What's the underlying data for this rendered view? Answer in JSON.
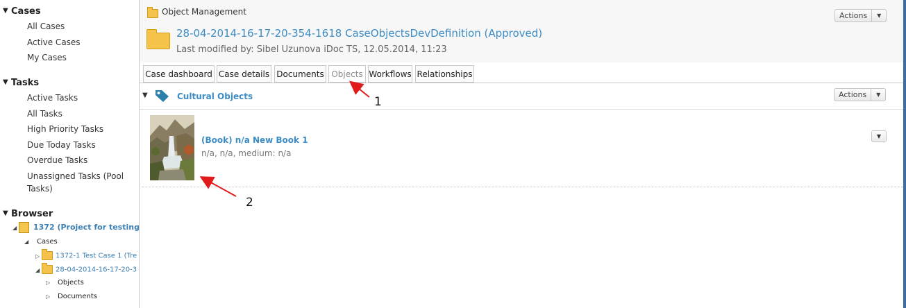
{
  "sidebar": {
    "cases": {
      "title": "Cases",
      "items": [
        "All Cases",
        "Active Cases",
        "My Cases"
      ]
    },
    "tasks": {
      "title": "Tasks",
      "items": [
        "Active Tasks",
        "All Tasks",
        "High Priority Tasks",
        "Due Today Tasks",
        "Overdue Tasks",
        "Unassigned Tasks (Pool",
        "Tasks)"
      ]
    },
    "browser": {
      "title": "Browser",
      "tree": {
        "project": "1372 (Project for testing)",
        "cases_label": "Cases",
        "case1": "1372-1 Test Case 1 (Tre",
        "case2": "28-04-2014-16-17-20-3",
        "objects": "Objects",
        "documents": "Documents"
      }
    }
  },
  "header": {
    "breadcrumb": "Object Management",
    "actions_label": "Actions",
    "case_title": "28-04-2014-16-17-20-354-1618 CaseObjectsDevDefinition (Approved)",
    "modified": "Last modified by: Sibel Uzunova iDoc TS, 12.05.2014, 11:23"
  },
  "tabs": [
    "Case dashboard",
    "Case details",
    "Documents",
    "Objects",
    "Workflows",
    "Relationships"
  ],
  "active_tab": "Objects",
  "section": {
    "title": "Cultural Objects",
    "actions_label": "Actions"
  },
  "object": {
    "title": "(Book) n/a New Book 1",
    "subtitle": "n/a, n/a, medium: n/a"
  },
  "annotations": {
    "one": "1",
    "two": "2"
  },
  "colors": {
    "link": "#3c8cc5",
    "tag_icon": "#2c7fa8",
    "annotation_arrow": "#e11b1b",
    "window_border": "#3a6ea5"
  }
}
